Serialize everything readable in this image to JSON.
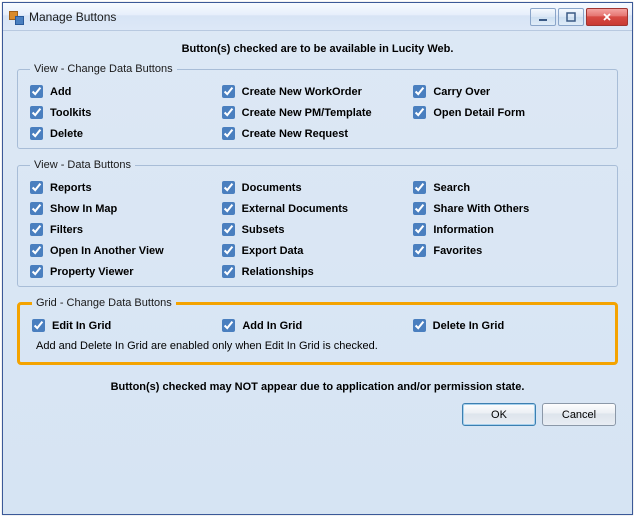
{
  "window": {
    "title": "Manage Buttons"
  },
  "headline": "Button(s) checked are to be available in Lucity Web.",
  "groups": {
    "change": {
      "legend": "View - Change Data Buttons",
      "col1": [
        {
          "label": "Add",
          "checked": true
        },
        {
          "label": "Toolkits",
          "checked": true
        },
        {
          "label": "Delete",
          "checked": true
        }
      ],
      "col2": [
        {
          "label": "Create New WorkOrder",
          "checked": true
        },
        {
          "label": "Create New PM/Template",
          "checked": true
        },
        {
          "label": "Create New Request",
          "checked": true
        }
      ],
      "col3": [
        {
          "label": "Carry Over",
          "checked": true
        },
        {
          "label": "Open Detail Form",
          "checked": true
        }
      ]
    },
    "data": {
      "legend": "View - Data Buttons",
      "col1": [
        {
          "label": "Reports",
          "checked": true
        },
        {
          "label": "Show In Map",
          "checked": true
        },
        {
          "label": "Filters",
          "checked": true
        },
        {
          "label": "Open In Another View",
          "checked": true
        },
        {
          "label": "Property Viewer",
          "checked": true
        }
      ],
      "col2": [
        {
          "label": "Documents",
          "checked": true
        },
        {
          "label": "External Documents",
          "checked": true
        },
        {
          "label": "Subsets",
          "checked": true
        },
        {
          "label": "Export Data",
          "checked": true
        },
        {
          "label": "Relationships",
          "checked": true
        }
      ],
      "col3": [
        {
          "label": "Search",
          "checked": true
        },
        {
          "label": "Share With Others",
          "checked": true
        },
        {
          "label": "Information",
          "checked": true
        },
        {
          "label": "Favorites",
          "checked": true
        }
      ]
    },
    "grid": {
      "legend": "Grid  - Change Data Buttons",
      "col1": [
        {
          "label": "Edit In Grid",
          "checked": true
        }
      ],
      "col2": [
        {
          "label": "Add In Grid",
          "checked": true
        }
      ],
      "col3": [
        {
          "label": "Delete In Grid",
          "checked": true
        }
      ],
      "note": "Add and Delete In Grid are enabled only when Edit In Grid is checked."
    }
  },
  "footnote": "Button(s) checked may NOT appear due to application and/or permission state.",
  "buttons": {
    "ok": "OK",
    "cancel": "Cancel"
  }
}
